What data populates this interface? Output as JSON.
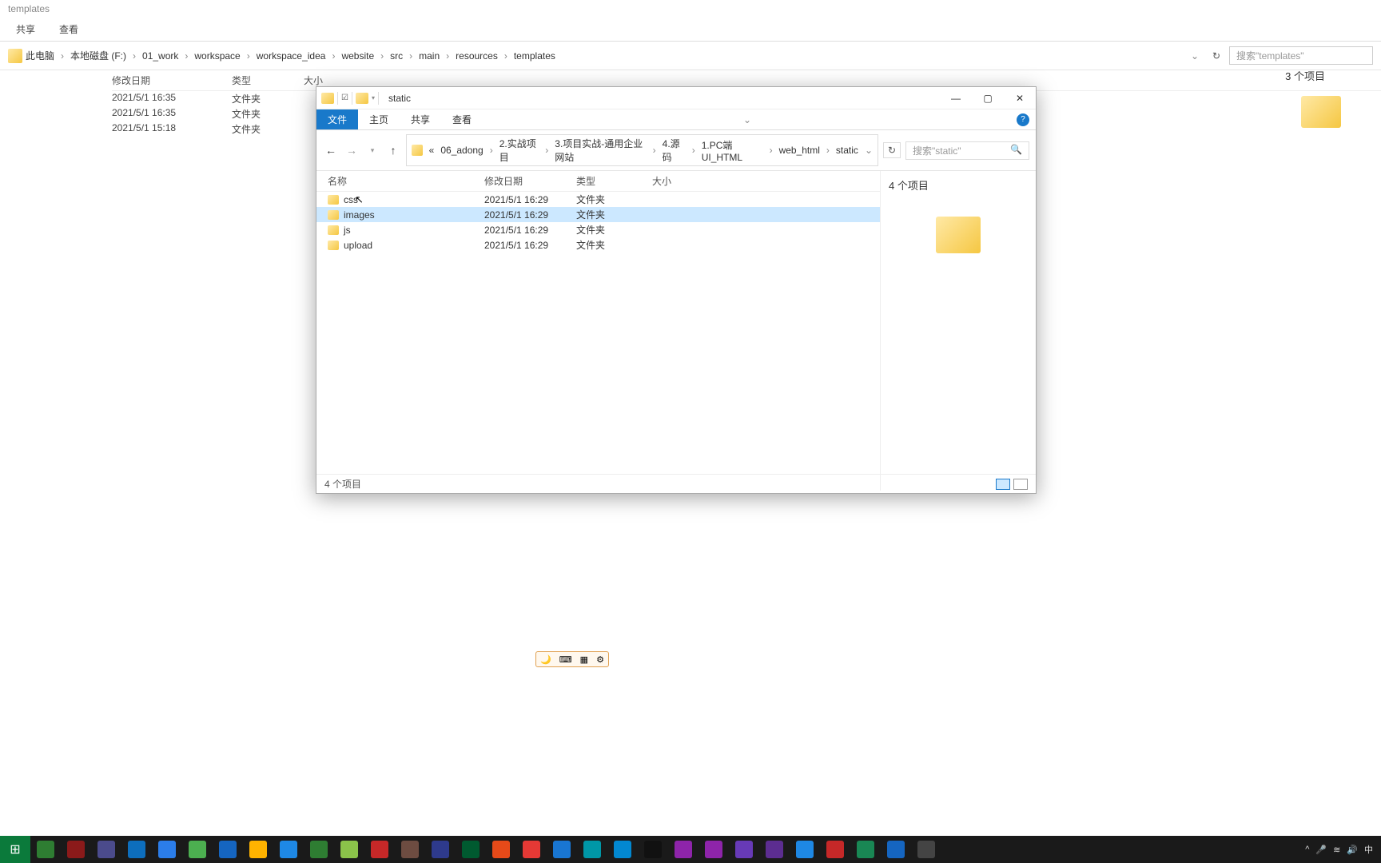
{
  "bg": {
    "title": "templates",
    "ribbon": {
      "share": "共享",
      "view": "查看"
    },
    "breadcrumb": [
      "此电脑",
      "本地磁盘 (F:)",
      "01_work",
      "workspace",
      "workspace_idea",
      "website",
      "src",
      "main",
      "resources",
      "templates"
    ],
    "search_placeholder": "搜索\"templates\"",
    "headers": {
      "date": "修改日期",
      "type": "类型",
      "size": "大小"
    },
    "rows": [
      {
        "date": "2021/5/1 16:35",
        "type": "文件夹"
      },
      {
        "date": "2021/5/1 16:35",
        "type": "文件夹"
      },
      {
        "date": "2021/5/1 15:18",
        "type": "文件夹"
      }
    ],
    "count": "3 个项目"
  },
  "fg": {
    "title": "static",
    "ribbon": {
      "file": "文件",
      "home": "主页",
      "share": "共享",
      "view": "查看"
    },
    "breadcrumb_prefix": "«",
    "breadcrumb": [
      "06_adong",
      "2.实战项目",
      "3.项目实战-通用企业网站",
      "4.源码",
      "1.PC端UI_HTML",
      "web_html",
      "static"
    ],
    "search_placeholder": "搜索\"static\"",
    "headers": {
      "name": "名称",
      "date": "修改日期",
      "type": "类型",
      "size": "大小"
    },
    "rows": [
      {
        "name": "css",
        "date": "2021/5/1 16:29",
        "type": "文件夹"
      },
      {
        "name": "images",
        "date": "2021/5/1 16:29",
        "type": "文件夹",
        "selected": true
      },
      {
        "name": "js",
        "date": "2021/5/1 16:29",
        "type": "文件夹"
      },
      {
        "name": "upload",
        "date": "2021/5/1 16:29",
        "type": "文件夹"
      }
    ],
    "preview_count": "4 个项目",
    "status": "4 个项目"
  },
  "float_tool": {
    "a": "🌙",
    "b": "⌨",
    "c": "▦",
    "d": "⚙"
  },
  "taskbar": {
    "icons_colors": [
      "#0b7a3b",
      "#2e7d32",
      "#8b1a1a",
      "#4b4b8c",
      "#0d6ebd",
      "#2b7de9",
      "#4caf50",
      "#1565c0",
      "#ffb300",
      "#1e88e5",
      "#2e7d32",
      "#8bc34a",
      "#c62828",
      "#6d4c41",
      "#2e3a8c",
      "#005a30",
      "#e64a19",
      "#e53935",
      "#1976d2",
      "#0097a7",
      "#0288d1",
      "#111111",
      "#8e24aa",
      "#8e24aa",
      "#673ab7",
      "#5c2d91",
      "#1e88e5",
      "#c62828",
      "#198754",
      "#1565c0",
      "#444444"
    ],
    "tray": {
      "ime": "中",
      "caret": "^"
    }
  }
}
